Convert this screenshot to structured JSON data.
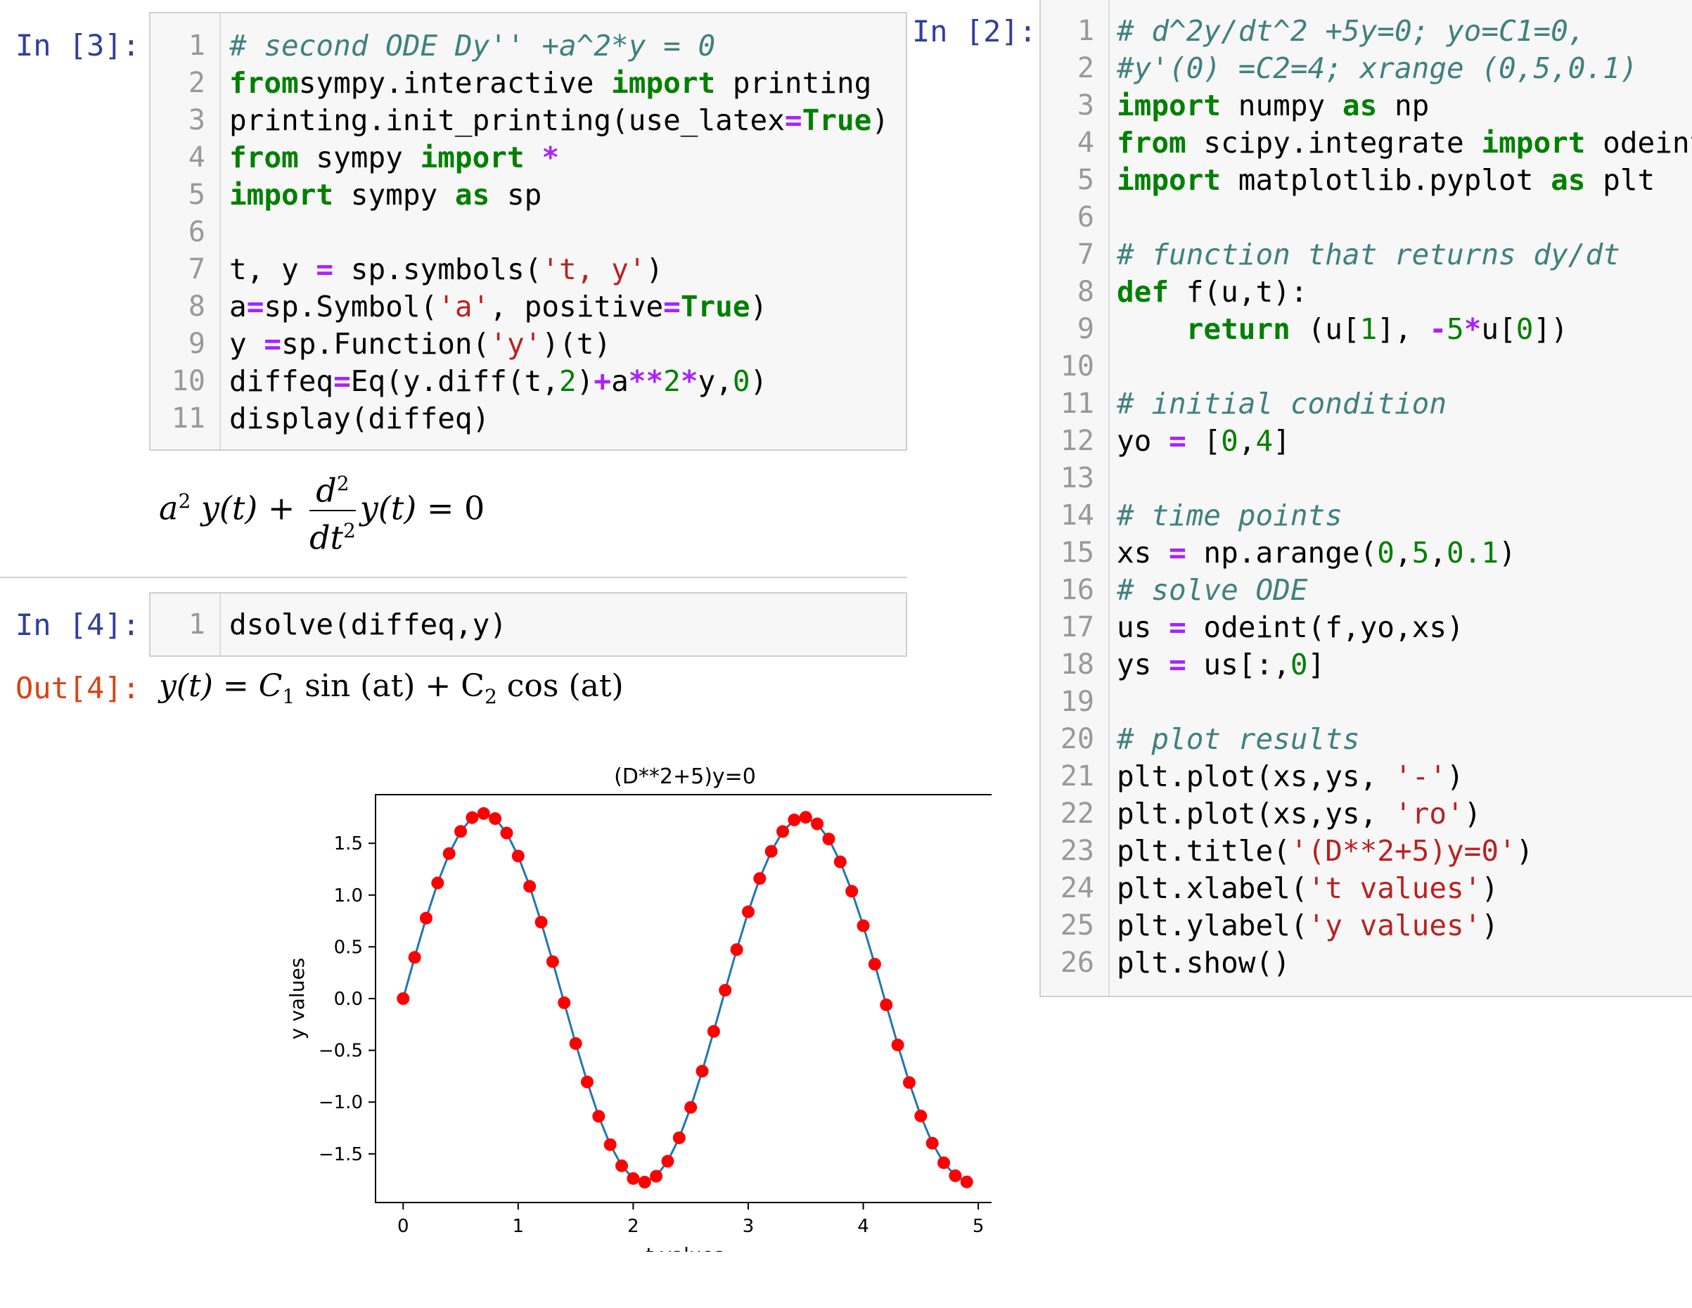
{
  "cells": [
    {
      "prompt": "In [3]:",
      "lines": [
        [
          [
            "cm",
            "# second ODE Dy'' +a^2*y = 0"
          ]
        ],
        [
          [
            "kw",
            "from"
          ],
          [
            "",
            "sympy.interactive "
          ],
          [
            "kw",
            "import"
          ],
          [
            "",
            " printing"
          ]
        ],
        [
          [
            "",
            "printing.init_printing(use_latex"
          ],
          [
            "op",
            "="
          ],
          [
            "kw",
            "True"
          ],
          [
            "",
            ")"
          ]
        ],
        [
          [
            "kw",
            "from"
          ],
          [
            "",
            " sympy "
          ],
          [
            "kw",
            "import"
          ],
          [
            "",
            ""
          ],
          [
            "op",
            " *"
          ]
        ],
        [
          [
            "kw",
            "import"
          ],
          [
            "",
            " sympy "
          ],
          [
            "kw",
            "as"
          ],
          [
            "",
            " sp"
          ]
        ],
        [],
        [
          [
            "",
            "t, y "
          ],
          [
            "op",
            "="
          ],
          [
            "",
            " sp.symbols("
          ],
          [
            "st",
            "'t, y'"
          ],
          [
            "",
            ")"
          ]
        ],
        [
          [
            "",
            "a"
          ],
          [
            "op",
            "="
          ],
          [
            "",
            "sp.Symbol("
          ],
          [
            "st",
            "'a'"
          ],
          [
            "",
            ", positive"
          ],
          [
            "op",
            "="
          ],
          [
            "kw",
            "True"
          ],
          [
            "",
            ")"
          ]
        ],
        [
          [
            "",
            "y "
          ],
          [
            "op",
            "="
          ],
          [
            "",
            "sp.Function("
          ],
          [
            "st",
            "'y'"
          ],
          [
            "",
            ")(t)"
          ]
        ],
        [
          [
            "",
            "diffeq"
          ],
          [
            "op",
            "="
          ],
          [
            "",
            "Eq(y.diff(t,"
          ],
          [
            "nu",
            "2"
          ],
          [
            "",
            ")"
          ],
          [
            "op",
            "+"
          ],
          [
            "",
            "a"
          ],
          [
            "op",
            "**"
          ],
          [
            "nu",
            "2"
          ],
          [
            "op",
            "*"
          ],
          [
            "",
            "y,"
          ],
          [
            "nu",
            "0"
          ],
          [
            "",
            ")"
          ]
        ],
        [
          [
            "",
            "display(diffeq)"
          ]
        ]
      ]
    },
    {
      "prompt": "In [4]:",
      "lines": [
        [
          [
            "",
            "dsolve(diffeq,y)"
          ]
        ]
      ]
    },
    {
      "prompt": "In [2]:",
      "lines": [
        [
          [
            "cm",
            "# d^2y/dt^2 +5y=0; yo=C1=0,"
          ]
        ],
        [
          [
            "cm",
            "#y'(0) =C2=4; xrange (0,5,0.1)"
          ]
        ],
        [
          [
            "kw",
            "import"
          ],
          [
            "",
            " numpy "
          ],
          [
            "kw",
            "as"
          ],
          [
            "",
            " np"
          ]
        ],
        [
          [
            "kw",
            "from"
          ],
          [
            "",
            " scipy.integrate "
          ],
          [
            "kw",
            "import"
          ],
          [
            "",
            " odeint"
          ]
        ],
        [
          [
            "kw",
            "import"
          ],
          [
            "",
            " matplotlib.pyplot "
          ],
          [
            "kw",
            "as"
          ],
          [
            "",
            " plt"
          ]
        ],
        [],
        [
          [
            "cm",
            "# function that returns dy/dt"
          ]
        ],
        [
          [
            "kw",
            "def"
          ],
          [
            "",
            " f(u,t):"
          ]
        ],
        [
          [
            "",
            "    "
          ],
          [
            "kw",
            "return"
          ],
          [
            "",
            " (u["
          ],
          [
            "nu",
            "1"
          ],
          [
            "",
            "], "
          ],
          [
            "op",
            "-"
          ],
          [
            "nu",
            "5"
          ],
          [
            "op",
            "*"
          ],
          [
            "",
            "u["
          ],
          [
            "nu",
            "0"
          ],
          [
            "",
            "])"
          ]
        ],
        [],
        [
          [
            "cm",
            "# initial condition"
          ]
        ],
        [
          [
            "",
            "yo "
          ],
          [
            "op",
            "="
          ],
          [
            "",
            " ["
          ],
          [
            "nu",
            "0"
          ],
          [
            "",
            ","
          ],
          [
            "nu",
            "4"
          ],
          [
            "",
            "]"
          ]
        ],
        [],
        [
          [
            "cm",
            "# time points"
          ]
        ],
        [
          [
            "",
            "xs "
          ],
          [
            "op",
            "="
          ],
          [
            "",
            " np.arange("
          ],
          [
            "nu",
            "0"
          ],
          [
            "",
            ","
          ],
          [
            "nu",
            "5"
          ],
          [
            "",
            ","
          ],
          [
            "nu",
            "0.1"
          ],
          [
            "",
            ")"
          ]
        ],
        [
          [
            "cm",
            "# solve ODE"
          ]
        ],
        [
          [
            "",
            "us "
          ],
          [
            "op",
            "="
          ],
          [
            "",
            " odeint(f,yo,xs)"
          ]
        ],
        [
          [
            "",
            "ys "
          ],
          [
            "op",
            "="
          ],
          [
            "",
            " us[:,"
          ],
          [
            "nu",
            "0"
          ],
          [
            "",
            "]"
          ]
        ],
        [],
        [
          [
            "cm",
            "# plot results"
          ]
        ],
        [
          [
            "",
            "plt.plot(xs,ys, "
          ],
          [
            "st",
            "'-'"
          ],
          [
            "",
            ")"
          ]
        ],
        [
          [
            "",
            "plt.plot(xs,ys, "
          ],
          [
            "st",
            "'ro'"
          ],
          [
            "",
            ")"
          ]
        ],
        [
          [
            "",
            "plt.title("
          ],
          [
            "st",
            "'(D**2+5)y=0'"
          ],
          [
            "",
            ")"
          ]
        ],
        [
          [
            "",
            "plt.xlabel("
          ],
          [
            "st",
            "'t values'"
          ],
          [
            "",
            ")"
          ]
        ],
        [
          [
            "",
            "plt.ylabel("
          ],
          [
            "st",
            "'y values'"
          ],
          [
            "",
            ")"
          ]
        ],
        [
          [
            "",
            "plt.show()"
          ]
        ]
      ]
    }
  ],
  "out4_prompt": "Out[4]:",
  "math1": {
    "a": "a",
    "sup2": "2",
    "yt": "y(t)",
    "plus": "+",
    "num": "d",
    "den": "dt",
    "yt2": "y(t)",
    "eq": "= 0"
  },
  "math2": {
    "text": "y(t) = C",
    "s1": "1",
    "sin": " sin (at) + C",
    "s2": "2",
    "cos": " cos (at)"
  },
  "colors": {
    "line": "#1f77b4",
    "marker": "#ff0000",
    "prompt_in": "#303f9f",
    "prompt_out": "#d84315"
  },
  "chart_data": {
    "type": "line",
    "title": "(D**2+5)y=0",
    "xlabel": "t values",
    "ylabel": "y values",
    "xlim": [
      -0.24,
      5.14
    ],
    "ylim": [
      -1.97,
      1.97
    ],
    "xticks": [
      0,
      1,
      2,
      3,
      4,
      5
    ],
    "yticks": [
      -1.5,
      -1.0,
      -0.5,
      0.0,
      0.5,
      1.0,
      1.5
    ],
    "xtick_labels": [
      "0",
      "1",
      "2",
      "3",
      "4",
      "5"
    ],
    "ytick_labels": [
      "−1.5",
      "−1.0",
      "−0.5",
      "0.0",
      "0.5",
      "1.0",
      "1.5"
    ],
    "x": [
      0.0,
      0.1,
      0.2,
      0.3,
      0.4,
      0.5,
      0.6,
      0.7,
      0.8,
      0.9,
      1.0,
      1.1,
      1.2,
      1.3,
      1.4,
      1.5,
      1.6,
      1.7,
      1.8,
      1.9,
      2.0,
      2.1,
      2.2,
      2.3,
      2.4,
      2.5,
      2.6,
      2.7,
      2.8,
      2.9,
      3.0,
      3.1,
      3.2,
      3.3,
      3.4,
      3.5,
      3.6,
      3.7,
      3.8,
      3.9,
      4.0,
      4.1,
      4.2,
      4.3,
      4.4,
      4.5,
      4.6,
      4.7,
      4.8,
      4.9
    ],
    "series": [
      {
        "values": [
          0.0,
          0.398,
          0.777,
          1.117,
          1.401,
          1.615,
          1.748,
          1.788,
          1.739,
          1.599,
          1.377,
          1.084,
          0.738,
          0.357,
          -0.04,
          -0.434,
          -0.805,
          -1.137,
          -1.411,
          -1.615,
          -1.738,
          -1.773,
          -1.716,
          -1.571,
          -1.345,
          -1.051,
          -0.701,
          -0.317,
          0.081,
          0.473,
          0.838,
          1.16,
          1.422,
          1.614,
          1.726,
          1.751,
          1.688,
          1.542,
          1.321,
          1.037,
          0.704,
          0.332,
          -0.06,
          -0.448,
          -0.811,
          -1.134,
          -1.397,
          -1.586,
          -1.711,
          -1.771
        ]
      }
    ]
  }
}
